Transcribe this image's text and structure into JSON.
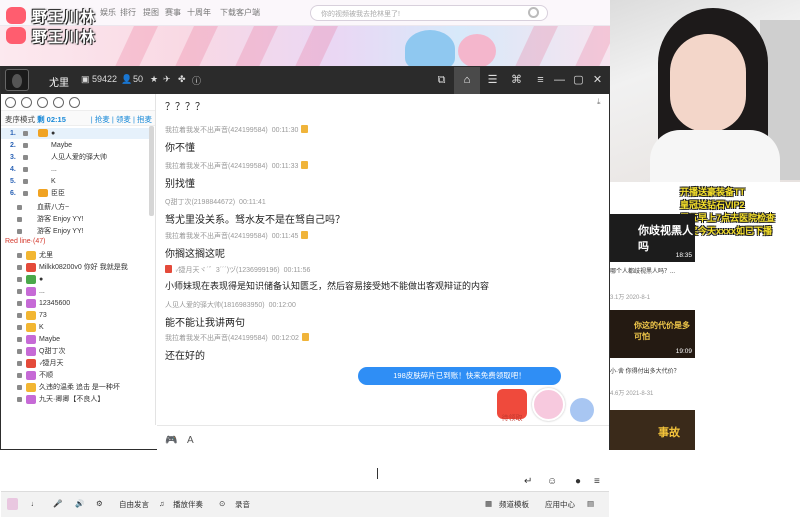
{
  "topbar": {
    "nav": [
      "",
      "娱乐",
      "排行",
      "提图",
      "赛事",
      "十周年",
      "下载客户端"
    ],
    "search_placeholder": "你的视频被我去抢林里了!"
  },
  "logo": {
    "line1": "野王川林",
    "line2": "野王川林"
  },
  "titlebar": {
    "name": "尤里",
    "members": "59422",
    "online": "50"
  },
  "leftpanel": {
    "mode_label": "麦序模式",
    "mode_time": "剩 02:15",
    "links": "| 抢麦 | 领麦 | 抱麦",
    "queue": [
      {
        "num": "1.",
        "nick": "●"
      },
      {
        "num": "2.",
        "nick": "Maybe"
      },
      {
        "num": "3.",
        "nick": "人见人爱的驿大帅"
      },
      {
        "num": "4.",
        "nick": "..."
      },
      {
        "num": "5.",
        "nick": "K"
      },
      {
        "num": "6.",
        "nick": "臣臣"
      }
    ],
    "members_top": [
      {
        "nick": "血薪八方~"
      },
      {
        "nick": "游客  Enjoy YY!"
      },
      {
        "nick": "游客  Enjoy YY!"
      }
    ],
    "redline_label": "Red line·(47)",
    "members": [
      {
        "nick": "尤里"
      },
      {
        "nick": "Milkk08200v0  你好 我就是我"
      },
      {
        "nick": "●"
      },
      {
        "nick": "..."
      },
      {
        "nick": "12345600"
      },
      {
        "nick": "73"
      },
      {
        "nick": "K"
      },
      {
        "nick": "Maybe"
      },
      {
        "nick": "Q甜丁次"
      },
      {
        "nick": "·⁄捷月天"
      },
      {
        "nick": "不顺"
      },
      {
        "nick": "久违的温柔   追击 是一种坏"
      },
      {
        "nick": "九天·卿卿【不良人】"
      }
    ]
  },
  "messages": [
    {
      "user": "",
      "time": "",
      "text": "？？？？"
    },
    {
      "user": "我拉着我发不出声音(424199584)",
      "time": "00:11:30",
      "text": "你不懂"
    },
    {
      "user": "我拉着我发不出声音(424199584)",
      "time": "00:11:33",
      "text": "别找懂"
    },
    {
      "user": "Q甜丁次(2198844672)",
      "time": "00:11:41",
      "text": "驽尤里没关系。驽水友不是在驽自己吗？"
    },
    {
      "user": "我拉着我发不出声音(424199584)",
      "time": "00:11:45",
      "text": "你搁这搁这呢"
    },
    {
      "user": "·⁄捷月天ヾ´゛3´´´)ヅ(1236999196)",
      "time": "00:11:56",
      "text": "小师妹现在表现得是知识储备认知匮乏，然后容易接受她不能做出客观辩证的内容"
    },
    {
      "user": "人见人爱的驿大帅(1816983950)",
      "time": "00:12:00",
      "text": "能不能让我讲两句"
    },
    {
      "user": "我拉着我发不出声音(424199584)",
      "time": "00:12:02",
      "text": "还在好的"
    }
  ],
  "notice_bubble": "198皮肤碎片已到账！快来免费领取吧！",
  "redpack_label": "待领取",
  "bottombar": {
    "free_speak": "自由发言",
    "music": "播放伴奏",
    "record": "录音",
    "channel_template": "频道模板",
    "app_center": "应用中心"
  },
  "overlay_lines": [
    "开播送豪装备TT",
    "皇冠送钻石VIP2",
    "周五早上7点去医院检查",
    "新奖今天xxxx如已下播"
  ],
  "videos": [
    {
      "title_overlay": "你歧视黑人吗",
      "duration": "18:35",
      "caption": "哪个人都歧视黑人吗？...",
      "stat": "3.1万  2020-8-1"
    },
    {
      "title_overlay": "你这的代价是多可怕",
      "duration": "19:09",
      "caption": "小·舍 你得付出多大代价？",
      "stat": "4.6万  2021-8-31"
    },
    {
      "title_overlay": "事故",
      "duration": "",
      "caption": "",
      "stat": ""
    }
  ],
  "colors": {
    "accent": "#2f8ef5",
    "titlebar": "#2b2b2b",
    "overlay_text": "#f7e12a"
  }
}
